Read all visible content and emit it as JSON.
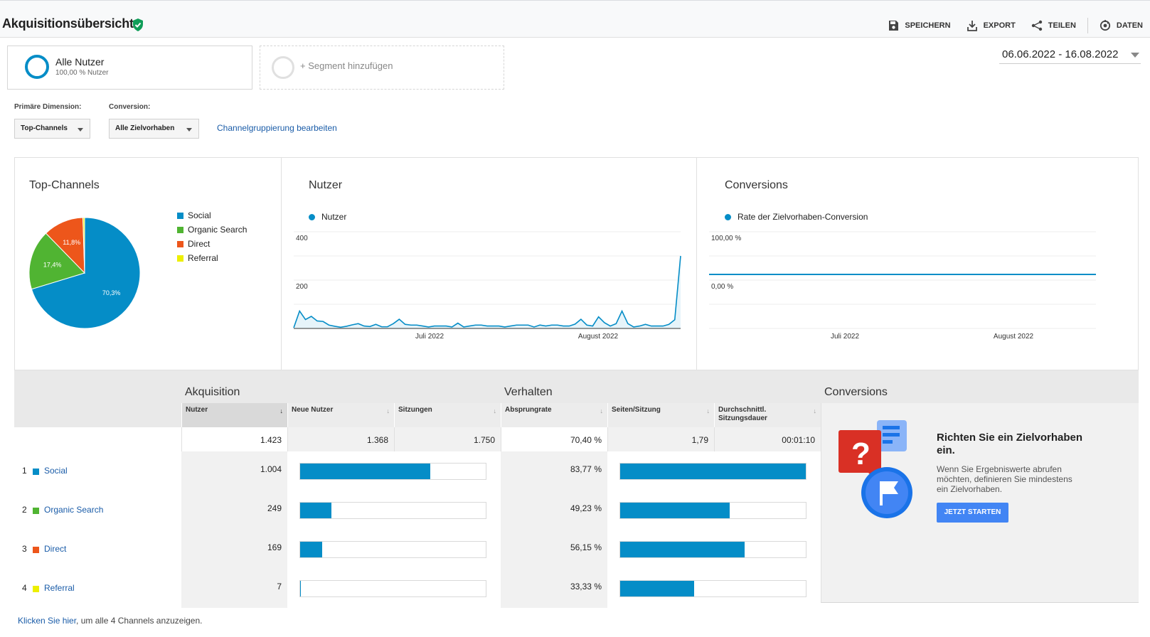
{
  "header": {
    "title": "Akquisitionsübersicht",
    "actions": {
      "save": "SPEICHERN",
      "export": "EXPORT",
      "share": "TEILEN",
      "insights": "DATEN"
    }
  },
  "segments": {
    "active": {
      "title": "Alle Nutzer",
      "subtitle": "100,00 % Nutzer"
    },
    "add_label": "+ Segment hinzufügen"
  },
  "date_range": "06.06.2022 - 16.08.2022",
  "filters": {
    "primary_dimension_label": "Primäre Dimension:",
    "primary_dimension_value": "Top-Channels",
    "conversion_label": "Conversion:",
    "conversion_value": "Alle Zielvorhaben",
    "edit_link": "Channelgruppierung bearbeiten"
  },
  "colors": {
    "social": "#058dc7",
    "organic_search": "#50b432",
    "direct": "#ed561b",
    "referral": "#edef00",
    "accent": "#4285f4",
    "link": "#1a5ca8"
  },
  "chart_data": [
    {
      "type": "pie",
      "title": "Top-Channels",
      "categories": [
        "Social",
        "Organic Search",
        "Direct",
        "Referral"
      ],
      "values": [
        70.3,
        17.4,
        11.8,
        0.5
      ],
      "labels": [
        "70,3%",
        "17,4%",
        "11,8%",
        ""
      ]
    },
    {
      "type": "line",
      "title": "Nutzer",
      "legend": "Nutzer",
      "y_ticks": [
        "400",
        "200"
      ],
      "ylim": [
        0,
        400
      ],
      "x_ticks": [
        "Juli 2022",
        "August 2022"
      ],
      "series": [
        {
          "name": "Nutzer",
          "values": [
            3,
            72,
            37,
            50,
            31,
            29,
            14,
            9,
            5,
            9,
            15,
            20,
            10,
            8,
            17,
            7,
            7,
            20,
            38,
            17,
            14,
            14,
            10,
            6,
            10,
            10,
            10,
            6,
            22,
            6,
            10,
            14,
            14,
            10,
            10,
            10,
            6,
            10,
            14,
            14,
            14,
            6,
            14,
            10,
            14,
            14,
            10,
            10,
            18,
            38,
            14,
            10,
            48,
            24,
            10,
            20,
            72,
            20,
            6,
            10,
            17,
            10,
            10,
            10,
            17,
            36,
            300
          ]
        }
      ]
    },
    {
      "type": "line",
      "title": "Conversions",
      "legend": "Rate der Zielvorhaben-Conversion",
      "y_ticks": [
        "100,00 %",
        "0,00 %"
      ],
      "x_ticks": [
        "Juli 2022",
        "August 2022"
      ],
      "series": [
        {
          "name": "Rate der Zielvorhaben-Conversion",
          "values": [
            0,
            0
          ]
        }
      ]
    }
  ],
  "table": {
    "groups": {
      "acquisition": "Akquisition",
      "behavior": "Verhalten",
      "conversions": "Conversions"
    },
    "columns": {
      "users": "Nutzer",
      "new_users": "Neue Nutzer",
      "sessions": "Sitzungen",
      "bounce_rate": "Absprungrate",
      "pages_session": "Seiten/Sitzung",
      "avg_duration_1": "Durchschnittl.",
      "avg_duration_2": "Sitzungsdauer"
    },
    "totals": {
      "users": "1.423",
      "new_users": "1.368",
      "sessions": "1.750",
      "bounce_rate": "70,40 %",
      "pages_session": "1,79",
      "avg_duration": "00:01:10"
    },
    "rows": [
      {
        "num": "1",
        "channel": "Social",
        "users": "1.004",
        "bounce_rate": "83,77 %",
        "new_users_share": 0.7,
        "bounce_share": 1.0
      },
      {
        "num": "2",
        "channel": "Organic Search",
        "users": "249",
        "bounce_rate": "49,23 %",
        "new_users_share": 0.17,
        "bounce_share": 0.59
      },
      {
        "num": "3",
        "channel": "Direct",
        "users": "169",
        "bounce_rate": "56,15 %",
        "new_users_share": 0.12,
        "bounce_share": 0.67
      },
      {
        "num": "4",
        "channel": "Referral",
        "users": "7",
        "bounce_rate": "33,33 %",
        "new_users_share": 0.004,
        "bounce_share": 0.4
      }
    ]
  },
  "goal_promo": {
    "title": "Richten Sie ein Zielvorhaben ein.",
    "text": "Wenn Sie Ergebniswerte abrufen möchten, definieren Sie mindestens ein Zielvorhaben.",
    "button": "JETZT STARTEN"
  },
  "footer": {
    "link": "Klicken Sie hier",
    "text": ", um alle 4 Channels anzuzeigen."
  }
}
